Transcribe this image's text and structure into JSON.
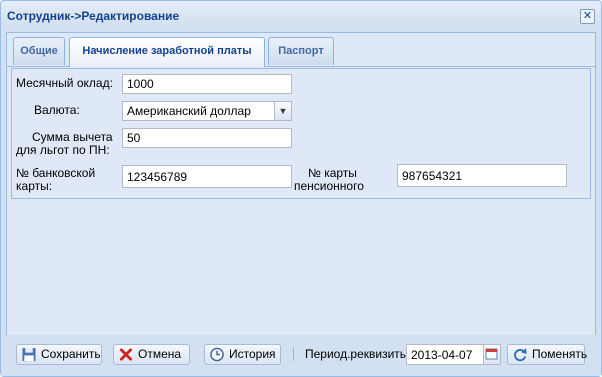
{
  "window": {
    "title": "Сотрудник->Редактирование",
    "close_glyph": "✕"
  },
  "tabs": [
    {
      "label": "Общие"
    },
    {
      "label": "Начисление заработной платы"
    },
    {
      "label": "Паспорт"
    }
  ],
  "form": {
    "salary_label": "Месячный оклад:",
    "salary_value": "1000",
    "currency_label": "Валюта:",
    "currency_value": "Американский доллар",
    "deduction_label_1": "Сумма вычета",
    "deduction_label_2": "для льгот по ПН:",
    "deduction_value": "50",
    "bank_card_label_1": "№ банковской",
    "bank_card_label_2": "карты:",
    "bank_card_value": "123456789",
    "pension_card_label_1": "№ карты",
    "pension_card_label_2": "пенсионного",
    "pension_card_value": "987654321"
  },
  "footer": {
    "save_label": "Сохранить",
    "cancel_label": "Отмена",
    "history_label": "История",
    "period_label": "Период.реквизиты:",
    "period_value": "2013-04-07",
    "change_label": "Поменять"
  },
  "icons": {
    "close": "close-icon",
    "dropdown": "chevron-down-icon",
    "save": "floppy-disk-icon",
    "cancel": "red-x-icon",
    "history": "clock-icon",
    "calendar": "calendar-icon",
    "change": "refresh-icon"
  },
  "colors": {
    "accent": "#15428b",
    "panel": "#dfe8f6",
    "border": "#99bbe8"
  }
}
